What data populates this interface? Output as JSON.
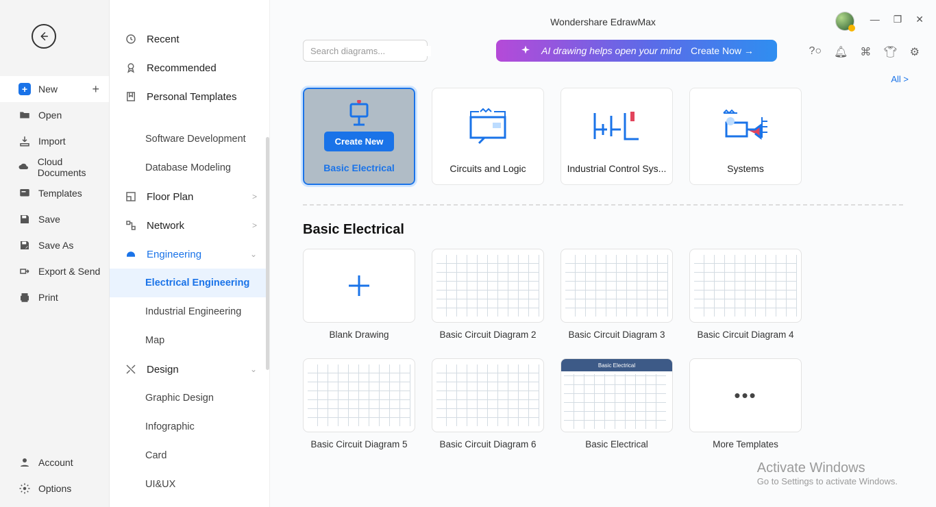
{
  "app_title": "Wondershare EdrawMax",
  "window_controls": {
    "min": "—",
    "max": "❐",
    "close": "✕"
  },
  "left_nav": {
    "items": [
      {
        "label": "New",
        "active": true,
        "plus": true
      },
      {
        "label": "Open"
      },
      {
        "label": "Import"
      },
      {
        "label": "Cloud Documents"
      },
      {
        "label": "Templates"
      },
      {
        "label": "Save"
      },
      {
        "label": "Save As"
      },
      {
        "label": "Export & Send"
      },
      {
        "label": "Print"
      }
    ],
    "bottom": [
      {
        "label": "Account"
      },
      {
        "label": "Options"
      }
    ]
  },
  "categories": [
    {
      "label": "Recent",
      "type": "item"
    },
    {
      "label": "Recommended",
      "type": "item"
    },
    {
      "label": "Personal Templates",
      "type": "item"
    },
    {
      "label": "Software Development",
      "type": "sub"
    },
    {
      "label": "Database Modeling",
      "type": "sub"
    },
    {
      "label": "Floor Plan",
      "type": "item",
      "chev": ">"
    },
    {
      "label": "Network",
      "type": "item",
      "chev": ">"
    },
    {
      "label": "Engineering",
      "type": "item",
      "chev": "⌄",
      "expanded": true
    },
    {
      "label": "Electrical Engineering",
      "type": "sub",
      "active": true
    },
    {
      "label": "Industrial Engineering",
      "type": "sub"
    },
    {
      "label": "Map",
      "type": "sub"
    },
    {
      "label": "Design",
      "type": "item",
      "chev": "⌄"
    },
    {
      "label": "Graphic Design",
      "type": "sub"
    },
    {
      "label": "Infographic",
      "type": "sub"
    },
    {
      "label": "Card",
      "type": "sub"
    },
    {
      "label": "UI&UX",
      "type": "sub"
    }
  ],
  "search": {
    "placeholder": "Search diagrams..."
  },
  "ai_banner": {
    "text": "AI drawing helps open your mind",
    "cta": "Create Now →"
  },
  "all_link": "All   >",
  "type_cards": [
    {
      "label": "Basic Electrical",
      "selected": true,
      "create": "Create New"
    },
    {
      "label": "Circuits and Logic"
    },
    {
      "label": "Industrial Control Sys..."
    },
    {
      "label": "Systems"
    }
  ],
  "section_title": "Basic Electrical",
  "templates_row1": [
    {
      "label": "Blank Drawing",
      "kind": "blank"
    },
    {
      "label": "Basic Circuit Diagram 2",
      "kind": "circuit"
    },
    {
      "label": "Basic Circuit Diagram 3",
      "kind": "circuit"
    },
    {
      "label": "Basic Circuit Diagram 4",
      "kind": "circuit"
    }
  ],
  "templates_row2": [
    {
      "label": "Basic Circuit Diagram 5",
      "kind": "circuit"
    },
    {
      "label": "Basic Circuit Diagram 6",
      "kind": "circuit"
    },
    {
      "label": "Basic Electrical",
      "kind": "header"
    },
    {
      "label": "More Templates",
      "kind": "more"
    }
  ],
  "watermark": {
    "t1": "Activate Windows",
    "t2": "Go to Settings to activate Windows."
  }
}
